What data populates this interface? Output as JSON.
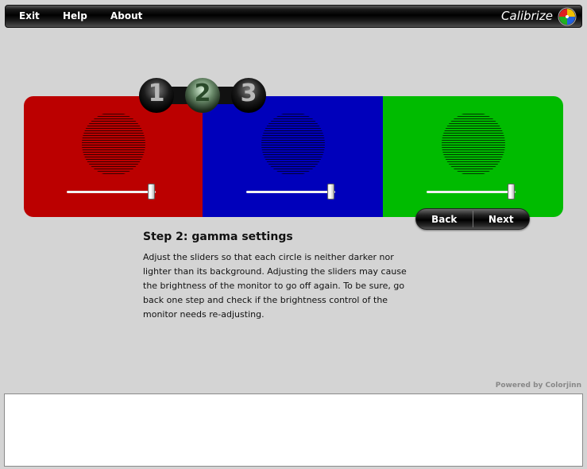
{
  "menu": {
    "exit": "Exit",
    "help": "Help",
    "about": "About",
    "brand": "Calibrize"
  },
  "steps": {
    "one": "1",
    "two": "2",
    "three": "3",
    "current": 2
  },
  "panels": {
    "red": {
      "color": "#bb0000",
      "slider_value": 0.95
    },
    "blue": {
      "color": "#0000bb",
      "slider_value": 0.95
    },
    "green": {
      "color": "#00bb00",
      "slider_value": 0.95
    }
  },
  "nav": {
    "back": "Back",
    "next": "Next"
  },
  "content": {
    "title": "Step 2: gamma settings",
    "description": "Adjust the sliders so that each circle is neither darker nor lighter than its background. Adjusting the sliders may cause the brightness of the monitor to go off again. To be sure, go back one step and check if the brightness control of the monitor needs re-adjusting."
  },
  "footer": {
    "powered_by": "Powered by Colorjinn"
  }
}
